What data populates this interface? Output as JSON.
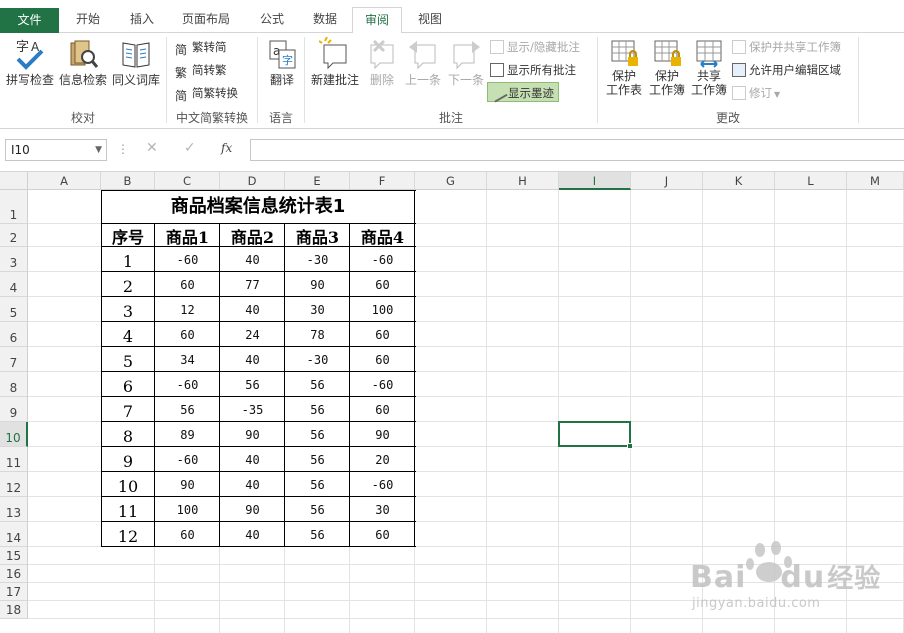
{
  "tabs": [
    {
      "label": "文件"
    },
    {
      "label": "开始"
    },
    {
      "label": "插入"
    },
    {
      "label": "页面布局"
    },
    {
      "label": "公式"
    },
    {
      "label": "数据"
    },
    {
      "label": "审阅"
    },
    {
      "label": "视图"
    }
  ],
  "active_tab": "审阅",
  "ribbon": {
    "proofing": {
      "spell": "拼写检查",
      "research": "信息检索",
      "thesaurus": "同义词库",
      "group": "校对"
    },
    "chinese": {
      "to_simplified": "繁转简",
      "to_traditional": "简转繁",
      "convert": "简繁转换",
      "group": "中文简繁转换"
    },
    "language": {
      "translate": "翻译",
      "group": "语言"
    },
    "comments": {
      "new": "新建批注",
      "delete": "删除",
      "prev": "上一条",
      "next": "下一条",
      "show_hide": "显示/隐藏批注",
      "show_all": "显示所有批注",
      "show_ink": "显示墨迹",
      "group": "批注"
    },
    "changes": {
      "protect_sheet_1": "保护",
      "protect_sheet_2": "工作表",
      "protect_book_1": "保护",
      "protect_book_2": "工作簿",
      "share_1": "共享",
      "share_2": "工作簿",
      "protect_share": "保护并共享工作簿",
      "allow_edit": "允许用户编辑区域",
      "track": "修订",
      "group": "更改"
    }
  },
  "formula_bar": {
    "name_box": "I10",
    "fx": "fx",
    "formula": ""
  },
  "columns": [
    "A",
    "B",
    "C",
    "D",
    "E",
    "F",
    "G",
    "H",
    "I",
    "J",
    "K",
    "L",
    "M"
  ],
  "rows": [
    "1",
    "2",
    "3",
    "4",
    "5",
    "6",
    "7",
    "8",
    "9",
    "10",
    "11",
    "12",
    "13",
    "14",
    "15",
    "16",
    "17",
    "18"
  ],
  "selected_cell": "I10",
  "sheet": {
    "title": "商品档案信息统计表1",
    "headers": [
      "序号",
      "商品1",
      "商品2",
      "商品3",
      "商品4"
    ],
    "rows": [
      [
        "1",
        "-60",
        "40",
        "-30",
        "-60"
      ],
      [
        "2",
        "60",
        "77",
        "90",
        "60"
      ],
      [
        "3",
        "12",
        "40",
        "30",
        "100"
      ],
      [
        "4",
        "60",
        "24",
        "78",
        "60"
      ],
      [
        "5",
        "34",
        "40",
        "-30",
        "60"
      ],
      [
        "6",
        "-60",
        "56",
        "56",
        "-60"
      ],
      [
        "7",
        "56",
        "-35",
        "56",
        "60"
      ],
      [
        "8",
        "89",
        "90",
        "56",
        "90"
      ],
      [
        "9",
        "-60",
        "40",
        "56",
        "20"
      ],
      [
        "10",
        "90",
        "40",
        "56",
        "-60"
      ],
      [
        "11",
        "100",
        "90",
        "56",
        "30"
      ],
      [
        "12",
        "60",
        "40",
        "56",
        "60"
      ]
    ]
  },
  "watermark": {
    "brand": "Bai",
    "brand2": "du",
    "suffix": "经验",
    "url": "jingyan.baidu.com"
  },
  "colors": {
    "accent": "#217346",
    "grid": "#e3e3e3",
    "header_bg": "#f1f1f1"
  }
}
